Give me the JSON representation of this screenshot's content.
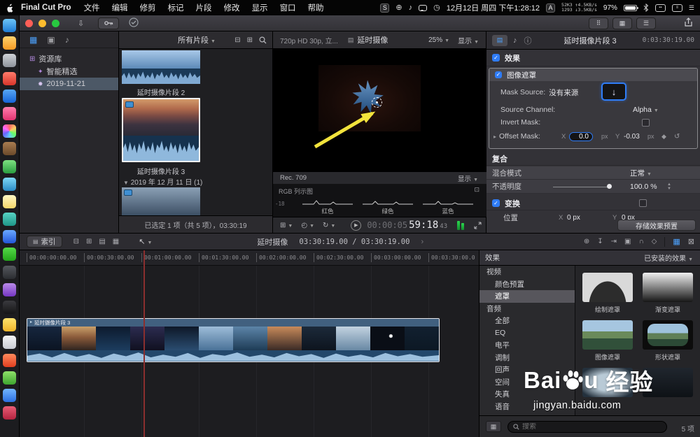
{
  "menubar": {
    "app_name": "Final Cut Pro",
    "menus": [
      "文件",
      "编辑",
      "修剪",
      "标记",
      "片段",
      "修改",
      "显示",
      "窗口",
      "帮助"
    ],
    "datetime": "12月12日 周四 下午1:28:12",
    "net_line1": "52K3 ↑4.5KB/s",
    "net_line2": "1293 ↓3.5KB/s",
    "battery_pct": "97%"
  },
  "sidebar": {
    "libraries_label": "资源库",
    "smart_collection": "智能精选",
    "event": "2019-11-21"
  },
  "browser": {
    "filter_label": "所有片段",
    "clip_above_label": "延时摄像片段 2",
    "selected_clip_label": "延时摄像片段 3",
    "group_label": "2019 年 12 月 11 日  (1)",
    "status_text": "已选定 1 项（共 5 项），03:30:19"
  },
  "viewer": {
    "format_label": "720p HD 30p, 立...",
    "project_label": "延时摄像",
    "zoom_label": "25%",
    "view_label": "显示",
    "rec_label": "Rec. 709",
    "rec_view_label": "显示",
    "scope_title": "RGB 列示图",
    "scope_db": "-18",
    "scope_channels": [
      "红色",
      "绿色",
      "蓝色"
    ],
    "tc_dim": "00:00:05",
    "tc_main": "59:18",
    "tc_sub": "43"
  },
  "inspector": {
    "clip_title": "延时摄像片段 3",
    "clip_duration": "0:03:30:19.00",
    "effects_header": "效果",
    "image_mask": {
      "title": "图像遮罩",
      "mask_source_label": "Mask Source:",
      "mask_source_value": "没有来源",
      "source_channel_label": "Source Channel:",
      "source_channel_value": "Alpha",
      "invert_mask_label": "Invert Mask:",
      "offset_mask_label": "Offset Mask:",
      "offset_x_label": "X",
      "offset_x_value": "0.0",
      "offset_x_unit": "px",
      "offset_y_label": "Y",
      "offset_y_value": "-0.03",
      "offset_y_unit": "px"
    },
    "compositing_header": "复合",
    "blend_mode_label": "混合模式",
    "blend_mode_value": "正常",
    "opacity_label": "不透明度",
    "opacity_value": "100.0 %",
    "transform_header": "变换",
    "position_label": "位置",
    "position_x_label": "X",
    "position_x_value": "0 px",
    "position_y_label": "Y",
    "position_y_value": "0 px",
    "save_preset_label": "存储效果预置"
  },
  "timeline_toolbar": {
    "index_label": "索引",
    "project_name": "延时摄像",
    "timecode": "03:30:19.00 / 03:30:19.00"
  },
  "timeline": {
    "ruler_labels": [
      "00:00:00:00.00",
      "00:00:30:00.00",
      "00:01:00:00.00",
      "00:01:30:00.00",
      "00:02:00:00.00",
      "00:02:30:00.00",
      "00:03:00:00.00",
      "00:03:30:00.0"
    ],
    "clip_name": "延时摄像片段 3"
  },
  "effects_panel": {
    "header_left": "效果",
    "header_right": "已安装的效果",
    "categories": [
      {
        "label": "视频"
      },
      {
        "label": "颜色预置"
      },
      {
        "label": "遮罩"
      },
      {
        "label": "音频"
      },
      {
        "label": "全部"
      },
      {
        "label": "EQ"
      },
      {
        "label": "电平"
      },
      {
        "label": "调制"
      },
      {
        "label": "回声"
      },
      {
        "label": "空间"
      },
      {
        "label": "失真"
      },
      {
        "label": "语音"
      }
    ],
    "effects": [
      "绘制遮罩",
      "渐变遮罩",
      "图像遮罩",
      "形状遮罩"
    ],
    "search_placeholder": "搜索",
    "count_label": "5 项"
  },
  "watermark": {
    "brand_prefix": "Bai",
    "brand_suffix": "u",
    "brand_cn": "经验",
    "url": "jingyan.baidu.com"
  }
}
